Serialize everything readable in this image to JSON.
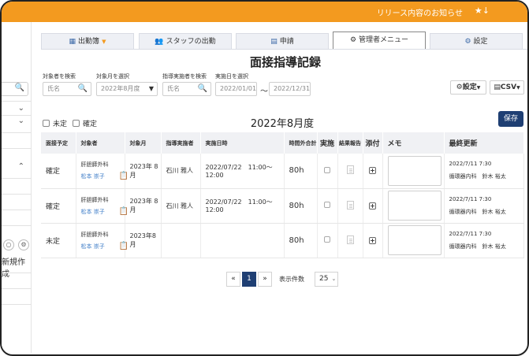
{
  "topbar": {
    "notice": "リリース内容のお知らせ",
    "icons": "★↓"
  },
  "sidebar": {
    "new_label": "新規作成"
  },
  "tabs": [
    {
      "label": "出勤簿",
      "icon": "table-icon",
      "dropdown": true
    },
    {
      "label": "スタッフの出勤",
      "icon": "users-icon"
    },
    {
      "label": "申請",
      "icon": "document-icon"
    },
    {
      "label": "管理者メニュー",
      "icon": "gears-icon",
      "active": true
    },
    {
      "label": "設定",
      "icon": "gear-icon"
    }
  ],
  "title": "面接指導記録",
  "filters": {
    "target_label": "対象者を検索",
    "target_placeholder": "氏名",
    "month_label": "対象月を選択",
    "month_value": "2022年8月度",
    "guide_label": "指導実施者を検索",
    "guide_placeholder": "氏名",
    "date_label": "実施日を選択",
    "date_from": "2022/01/01",
    "date_to": "2022/12/31",
    "tilde": "〜"
  },
  "buttons": {
    "settings": "設定",
    "csv": "CSV",
    "save": "保存"
  },
  "status_filters": {
    "unconfirmed": "未定",
    "confirmed": "確定"
  },
  "month_title": "2022年8月度",
  "table": {
    "headers": [
      "面接予定",
      "対象者",
      "対象月",
      "指導実施者",
      "実施日時",
      "時間外合計",
      "実施",
      "結果報告",
      "添付",
      "メモ",
      "最終更新"
    ],
    "rows": [
      {
        "status": "確定",
        "dept": "肝胆膵外科",
        "name": "松本 崇子",
        "month": "2023年 8月",
        "guide": "石川 雅人",
        "datetime": "2022/07/22　11:00～12:00",
        "hours": "80h",
        "updated": "2022/7/11 7:30",
        "updated_by": "循環器内科　鈴木 裕太"
      },
      {
        "status": "確定",
        "dept": "肝胆膵外科",
        "name": "松本 崇子",
        "month": "2023年 8月",
        "guide": "石川 雅人",
        "datetime": "2022/07/22　11:00～12:00",
        "hours": "80h",
        "updated": "2022/7/11 7:30",
        "updated_by": "循環器内科　鈴木 裕太"
      },
      {
        "status": "未定",
        "dept": "肝胆膵外科",
        "name": "松本 崇子",
        "month": "2023年8月",
        "guide": "",
        "datetime": "",
        "hours": "80h",
        "updated": "2022/7/11 7:30",
        "updated_by": "循環器内科　鈴木 裕太"
      }
    ]
  },
  "pagination": {
    "prev": "«",
    "current": "1",
    "next": "»",
    "per_page_label": "表示件数",
    "per_page": "25"
  },
  "colors": {
    "topbar": "#f39a1f",
    "primary": "#1f3f73",
    "link": "#3b7bc7"
  }
}
